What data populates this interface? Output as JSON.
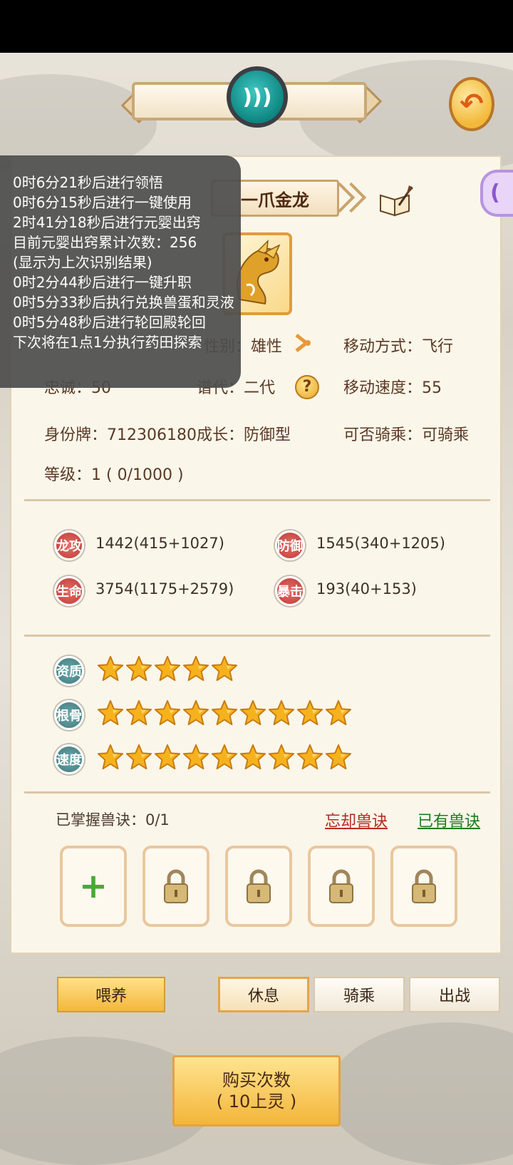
{
  "overlay": {
    "lines": [
      "0时6分21秒后进行领悟",
      "0时6分15秒后进行一键使用",
      "2时41分18秒后进行元婴出窍",
      "目前元婴出窍累计次数：256",
      "(显示为上次识别结果)",
      "0时2分44秒后进行一键升职",
      "0时5分33秒后执行兑换兽蛋和灵液",
      "0时5分48秒后进行轮回殿轮回",
      "下次将在1点1分执行药田探索"
    ]
  },
  "pet": {
    "name": "一爪金龙",
    "gender_label": "性别：",
    "gender": "雄性",
    "move_type_label": "移动方式：",
    "move_type": "飞行",
    "loyalty_label": "忠诚：",
    "loyalty": "50",
    "generation_label": "谱代：",
    "generation": "二代",
    "move_speed_label": "移动速度：",
    "move_speed": "55",
    "id_label": "身份牌：",
    "id": "712306180",
    "growth_label": "成长：",
    "growth": "防御型",
    "rideable_label": "可否骑乘：",
    "rideable": "可骑乘",
    "level_label": "等级：",
    "level": "1 ( 0/1000 )"
  },
  "stats": [
    {
      "badge": "龙攻",
      "value": "1442(415+1027)",
      "color": "#c9443f"
    },
    {
      "badge": "防御",
      "value": "1545(340+1205)",
      "color": "#c9443f"
    },
    {
      "badge": "生命",
      "value": "3754(1175+2579)",
      "color": "#c9443f"
    },
    {
      "badge": "暴击",
      "value": "193(40+153)",
      "color": "#c9443f"
    }
  ],
  "ratings": [
    {
      "badge": "资质",
      "stars": 5
    },
    {
      "badge": "根骨",
      "stars": 9
    },
    {
      "badge": "速度",
      "stars": 9
    }
  ],
  "skills": {
    "label": "已掌握兽诀：0/1",
    "forget_link": "忘却兽诀",
    "owned_link": "已有兽诀"
  },
  "buttons": {
    "feed": "喂养",
    "rest": "休息",
    "ride": "骑乘",
    "battle": "出战",
    "buy_line1": "购买次数",
    "buy_line2": "( 10上灵 )"
  },
  "colors": {
    "red_link": "#b52b1f",
    "green_link": "#1f7a1f",
    "gold": "#f3b73c"
  }
}
